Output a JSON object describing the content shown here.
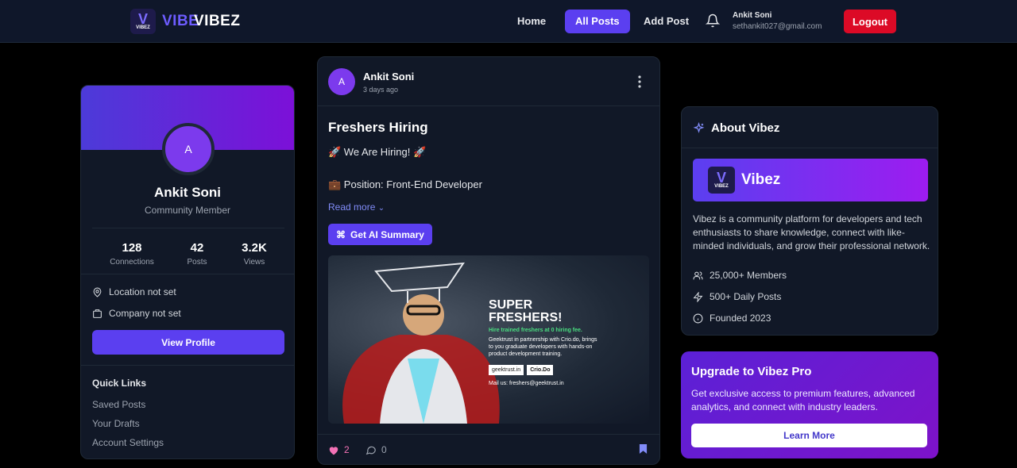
{
  "nav": {
    "logo_text_1": "VIBE",
    "logo_text_2": "VIBEZ",
    "logo_mark": "V",
    "logo_mark_small": "VIBEZ",
    "home": "Home",
    "all_posts": "All Posts",
    "add_post": "Add Post",
    "user_name": "Ankit Soni",
    "user_email": "sethankit027@gmail.com",
    "logout": "Logout"
  },
  "profile": {
    "initial": "A",
    "name": "Ankit Soni",
    "role": "Community Member",
    "stats": [
      {
        "value": "128",
        "label": "Connections"
      },
      {
        "value": "42",
        "label": "Posts"
      },
      {
        "value": "3.2K",
        "label": "Views"
      }
    ],
    "location": "Location not set",
    "company": "Company not set",
    "view_profile": "View Profile",
    "quick_links_title": "Quick Links",
    "quick_links": [
      "Saved Posts",
      "Your Drafts",
      "Account Settings"
    ]
  },
  "post": {
    "initial": "A",
    "author": "Ankit Soni",
    "time": "3 days ago",
    "title": "Freshers Hiring",
    "line1": "🚀 We Are Hiring! 🚀",
    "line2": "💼 Position: Front-End Developer",
    "read_more": "Read more",
    "ai_button": "Get AI Summary",
    "image": {
      "heading1": "SUPER",
      "heading2": "FRESHERS!",
      "tagline": "Hire trained freshers at 0 hiring fee.",
      "body": "Geektrust in partnership with Crio.do, brings to you graduate developers with hands-on product development training.",
      "brand1": "geektrust.in",
      "brand2": "Crio.Do",
      "mail": "Mail us: freshers@geektrust.in"
    },
    "likes": "2",
    "comments": "0"
  },
  "about": {
    "title": "About Vibez",
    "banner_mark": "V",
    "banner_mark_small": "VIBEZ",
    "banner_text": "Vibez",
    "description": "Vibez is a community platform for developers and tech enthusiasts to share knowledge, connect with like-minded individuals, and grow their professional network.",
    "members": "25,000+ Members",
    "daily_posts": "500+ Daily Posts",
    "founded": "Founded 2023"
  },
  "pro": {
    "title": "Upgrade to Vibez Pro",
    "description": "Get exclusive access to premium features, advanced analytics, and connect with industry leaders.",
    "button": "Learn More"
  },
  "colors": {
    "accent": "#5b3ff0",
    "logout": "#dc0a26",
    "like": "#f472b6"
  }
}
